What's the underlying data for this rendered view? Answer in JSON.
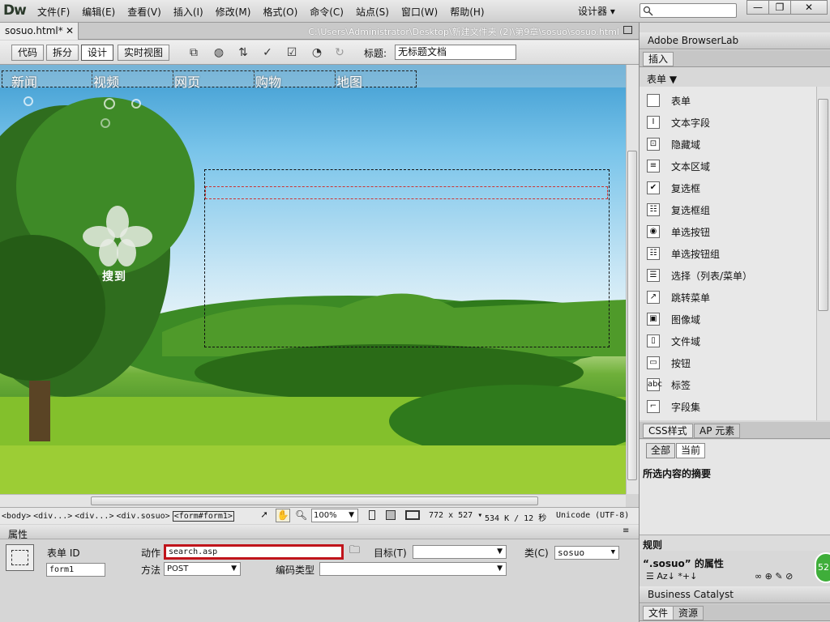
{
  "app": {
    "logo": "Dw",
    "workspace": "设计器",
    "window_close": "✕",
    "window_min": "—",
    "window_max": "❐"
  },
  "menu": [
    "文件(F)",
    "编辑(E)",
    "查看(V)",
    "插入(I)",
    "修改(M)",
    "格式(O)",
    "命令(C)",
    "站点(S)",
    "窗口(W)",
    "帮助(H)"
  ],
  "document": {
    "tab_name": "sosuo.html*",
    "tab_close": "✕",
    "path": "C:\\Users\\Administrator\\Desktop\\新建文件夹 (2)\\第9章\\sosuo\\sosuo.html"
  },
  "toolbar": {
    "views": [
      "代码",
      "拆分",
      "设计",
      "实时视图"
    ],
    "active_view": "设计",
    "title_label": "标题:",
    "title_value": "无标题文档"
  },
  "canvas": {
    "nav": [
      "新闻",
      "视频",
      "网页",
      "购物",
      "地图"
    ],
    "logo_text": "搜到"
  },
  "status": {
    "tags": [
      "<body>",
      "<div...>",
      "<div...>",
      "<div.sosuo>",
      "<form#form1>"
    ],
    "selected_tag": "<form#form1>",
    "zoom": "100%",
    "dimensions": "772 x 527",
    "filesize": "534 K / 12 秒",
    "encoding": "Unicode (UTF-8)"
  },
  "properties": {
    "title": "属性",
    "form_id_label": "表单 ID",
    "form_id_value": "form1",
    "action_label": "动作",
    "action_value": "search.asp",
    "target_label": "目标(T)",
    "target_value": "",
    "class_label": "类(C)",
    "class_value": "sosuo",
    "method_label": "方法",
    "method_value": "POST",
    "enctype_label": "编码类型",
    "enctype_value": ""
  },
  "panels": {
    "browserlab": "Adobe BrowserLab",
    "insert_tab": "插入",
    "insert_category": "表单",
    "insert_items": [
      {
        "label": "表单",
        "icon": "form-icon",
        "glyph": " "
      },
      {
        "label": "文本字段",
        "icon": "text-field-icon",
        "glyph": "I"
      },
      {
        "label": "隐藏域",
        "icon": "hidden-field-icon",
        "glyph": "⊡"
      },
      {
        "label": "文本区域",
        "icon": "textarea-icon",
        "glyph": "≡"
      },
      {
        "label": "复选框",
        "icon": "checkbox-icon",
        "glyph": "✔"
      },
      {
        "label": "复选框组",
        "icon": "checkbox-group-icon",
        "glyph": "☷"
      },
      {
        "label": "单选按钮",
        "icon": "radio-button-icon",
        "glyph": "◉"
      },
      {
        "label": "单选按钮组",
        "icon": "radio-group-icon",
        "glyph": "☷"
      },
      {
        "label": "选择（列表/菜单）",
        "icon": "select-list-icon",
        "glyph": "☰"
      },
      {
        "label": "跳转菜单",
        "icon": "jump-menu-icon",
        "glyph": "↗"
      },
      {
        "label": "图像域",
        "icon": "image-field-icon",
        "glyph": "▣"
      },
      {
        "label": "文件域",
        "icon": "file-field-icon",
        "glyph": "▯"
      },
      {
        "label": "按钮",
        "icon": "button-icon",
        "glyph": "▭"
      },
      {
        "label": "标签",
        "icon": "label-icon",
        "glyph": "abc"
      },
      {
        "label": "字段集",
        "icon": "fieldset-icon",
        "glyph": "⌐"
      }
    ],
    "css_tab": "CSS样式",
    "ap_tab": "AP 元素",
    "css_all": "全部",
    "css_current": "当前",
    "summary_title": "所选内容的摘要",
    "rules_title": "规则",
    "props_title": "“.sosuo” 的属性",
    "badge": "52",
    "business_catalyst": "Business Catalyst",
    "files_tab": "文件",
    "assets_tab": "资源"
  },
  "colors": {
    "action_border": "#c0141b",
    "accent_green": "#3fae3a"
  }
}
